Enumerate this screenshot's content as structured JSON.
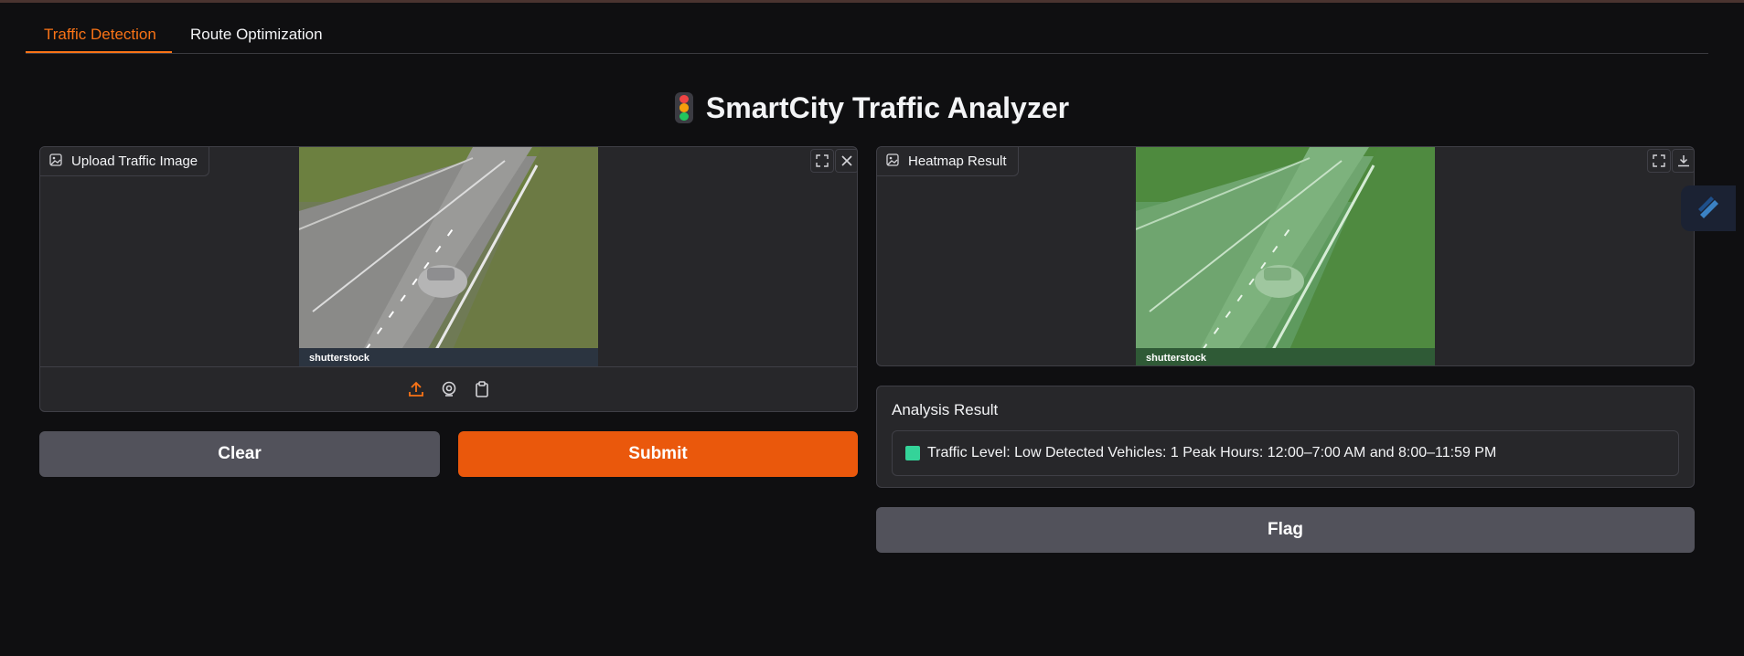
{
  "tabs": [
    {
      "label": "Traffic Detection",
      "active": true
    },
    {
      "label": "Route Optimization",
      "active": false
    }
  ],
  "header": {
    "title": "SmartCity Traffic Analyzer",
    "icon": "traffic-light-icon"
  },
  "input_panel": {
    "label": "Upload Traffic Image",
    "image_watermark": "shutterstock",
    "source_icons": [
      "upload-icon",
      "webcam-icon",
      "clipboard-icon"
    ],
    "actions": [
      "fullscreen-icon",
      "close-icon"
    ]
  },
  "output_panel": {
    "label": "Heatmap Result",
    "image_watermark": "shutterstock",
    "actions": [
      "fullscreen-icon",
      "download-icon"
    ]
  },
  "buttons": {
    "clear": "Clear",
    "submit": "Submit",
    "flag": "Flag"
  },
  "analysis": {
    "label": "Analysis Result",
    "text": "Traffic Level: Low Detected Vehicles: 1 Peak Hours: 12:00–7:00 AM and 8:00–11:59 PM",
    "level_color": "#34d399"
  },
  "colors": {
    "accent": "#f97316",
    "primary_button": "#ea580c",
    "secondary_button": "#52525b",
    "background": "#0f0f11",
    "panel": "#27272a"
  }
}
